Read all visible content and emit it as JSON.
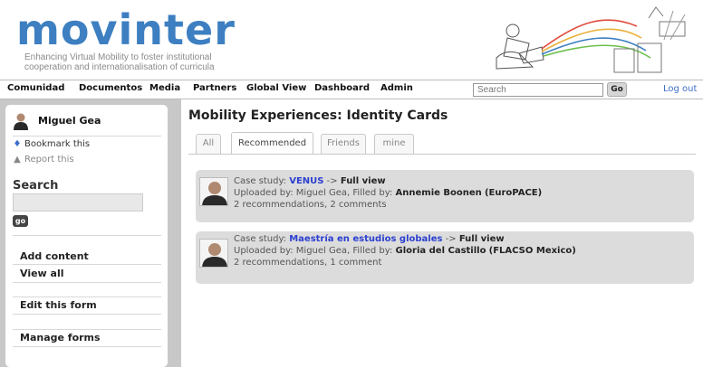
{
  "header": {
    "logo": "movinter",
    "tagline_1": "Enhancing Virtual Mobility to foster institutional",
    "tagline_2": "cooperation and internationalisation of curricula"
  },
  "nav": {
    "items": [
      "Comunidad",
      "Documentos",
      "Media",
      "Partners",
      "Global View",
      "Dashboard",
      "Admin"
    ],
    "search_placeholder": "Search",
    "go_label": "Go",
    "logout_label": "Log out"
  },
  "sidebar": {
    "user_name": "Miguel Gea",
    "bookmark_label": "Bookmark this",
    "report_label": "Report this",
    "search_title": "Search",
    "go_label": "go",
    "add_content": "Add content",
    "view_all": "View all",
    "edit_form": "Edit this form",
    "manage_forms": "Manage forms"
  },
  "main": {
    "title": "Mobility Experiences: Identity Cards",
    "tabs": [
      "All",
      "Recommended",
      "Friends",
      "mine"
    ],
    "active_tab": "Recommended",
    "cards": [
      {
        "prefix": "Case study:",
        "link": "VENUS",
        "arrow": "->",
        "full_view": "Full view",
        "uploaded_prefix": "Uploaded by: Miguel Gea, Filled by:",
        "filled_by": "Annemie Boonen",
        "org": "(EuroPACE)",
        "stats": "2 recommendations, 2 comments"
      },
      {
        "prefix": "Case study:",
        "link": "Maestría en estudios globales",
        "arrow": "->",
        "full_view": "Full view",
        "uploaded_prefix": "Uploaded by: Miguel Gea, Filled by:",
        "filled_by": "Gloria del Castillo",
        "org": "(FLACSO Mexico)",
        "stats": "2 recommendations, 1 comment"
      }
    ]
  },
  "colors": {
    "logo_blue": "#3d7fc1",
    "link_blue": "#2b3fd0",
    "card_bg": "#dcdcdc",
    "page_gray": "#c8c8c8"
  }
}
